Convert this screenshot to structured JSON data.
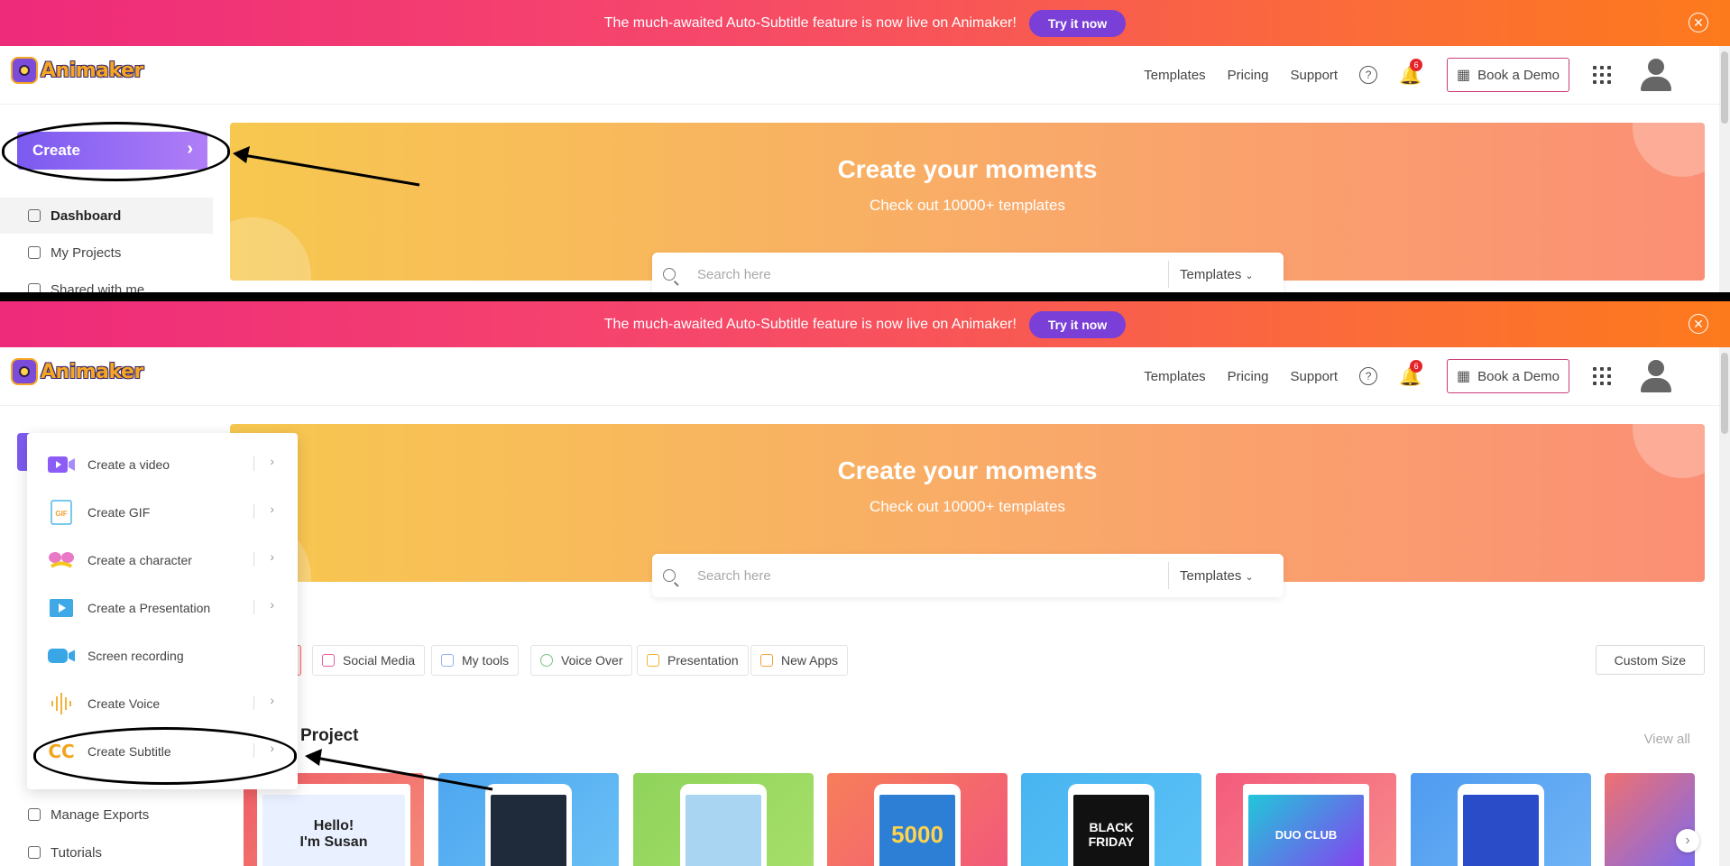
{
  "banner": {
    "text": "The much-awaited Auto-Subtitle feature is now live on Animaker!",
    "button": "Try it now",
    "close_glyph": "✕"
  },
  "brand": {
    "name": "Animaker"
  },
  "nav": {
    "templates": "Templates",
    "pricing": "Pricing",
    "support": "Support",
    "help_glyph": "?",
    "notifications_count": "6",
    "book_demo": "Book a Demo"
  },
  "create": {
    "label": "Create",
    "chevron": "›"
  },
  "sidebar": {
    "items": [
      "Dashboard",
      "My Projects",
      "Shared with me"
    ],
    "bottom_items": [
      "Manage Exports",
      "Tutorials"
    ]
  },
  "hero": {
    "title": "Create your moments",
    "subtitle": "Check out 10000+ templates"
  },
  "search": {
    "placeholder": "Search here",
    "dropdown_label": "Templates"
  },
  "create_menu": {
    "items": [
      {
        "label": "Create a video",
        "icon": "video-icon",
        "has_chevron": true
      },
      {
        "label": "Create GIF",
        "icon": "gif-icon",
        "has_chevron": true
      },
      {
        "label": "Create a character",
        "icon": "character-icon",
        "has_chevron": true
      },
      {
        "label": "Create a Presentation",
        "icon": "presentation-icon",
        "has_chevron": true
      },
      {
        "label": "Screen recording",
        "icon": "screen-recording-icon",
        "has_chevron": false
      },
      {
        "label": "Create Voice",
        "icon": "voice-icon",
        "has_chevron": true
      },
      {
        "label": "Create Subtitle",
        "icon": "subtitle-cc-icon",
        "has_chevron": true
      }
    ]
  },
  "categories": [
    "Social Media",
    "My tools",
    "Voice Over",
    "Presentation",
    "New Apps"
  ],
  "custom_size": "Custom Size",
  "projects": {
    "title_partial": "Project",
    "view_all": "View all",
    "card_texts": [
      "Hello!\nI'm Susan",
      "",
      "",
      "5000",
      "BLACK\nFRIDAY",
      "DUO CLUB",
      "",
      ""
    ]
  },
  "colors": {
    "accent_purple": "#7b5af0",
    "banner_pink": "#ee2a7b",
    "banner_orange": "#fd7a1c",
    "bell": "#f2a51d",
    "badge_red": "#e5232a"
  }
}
